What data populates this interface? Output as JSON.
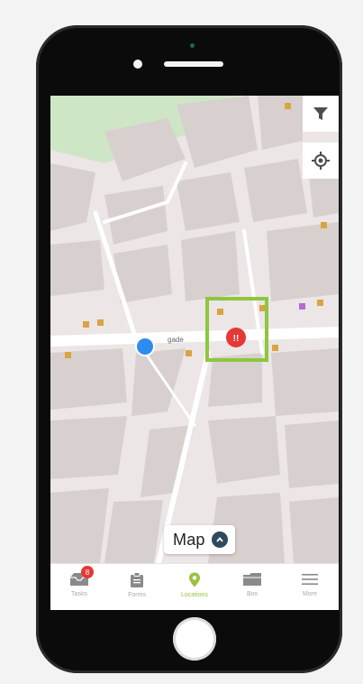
{
  "map": {
    "street_name": "gade",
    "chip_label": "Map",
    "highlight_color": "#8dc63f",
    "marker_color": "#e53935",
    "user_dot_color": "#2d8cf0",
    "pin_label": "!!"
  },
  "tabs": [
    {
      "label": "Tasks",
      "icon": "inbox-icon",
      "badge": "8",
      "active": false
    },
    {
      "label": "Forms",
      "icon": "clipboard-icon",
      "active": false
    },
    {
      "label": "Locations",
      "icon": "location-pin-icon",
      "active": true
    },
    {
      "label": "Box",
      "icon": "folder-icon",
      "active": false
    },
    {
      "label": "More",
      "icon": "menu-icon",
      "active": false
    }
  ],
  "colors": {
    "active_tab": "#9bc142",
    "inactive_tab": "#a9a9a9"
  }
}
